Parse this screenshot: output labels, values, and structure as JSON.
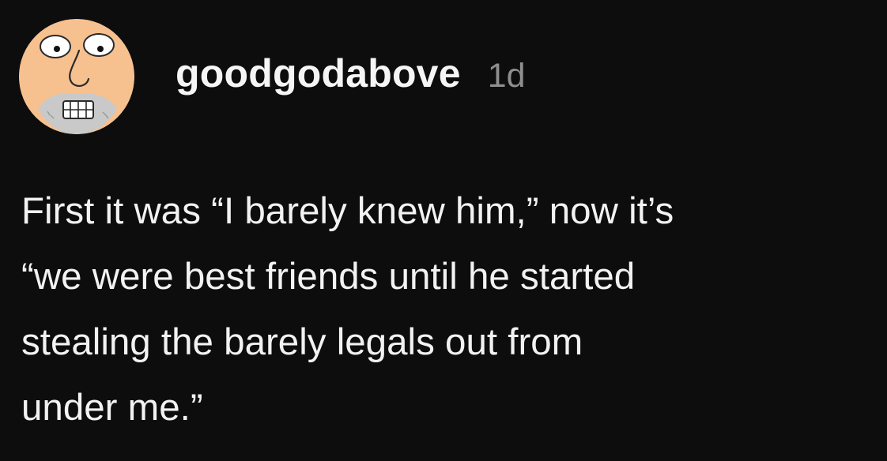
{
  "post": {
    "username": "goodgodabove",
    "timestamp": "1d",
    "avatar_icon": "cartoon-face-avatar",
    "text_lines": [
      "First it was “I barely knew him,” now it’s",
      "“we were best friends until he started",
      "stealing the barely legals out from",
      "under me.”"
    ]
  },
  "colors": {
    "background": "#0d0d0d",
    "text": "#f2f2f2",
    "timestamp": "#8e8e8e",
    "avatar_background": "#f6f5f3",
    "avatar_skin": "#f7c08f"
  }
}
